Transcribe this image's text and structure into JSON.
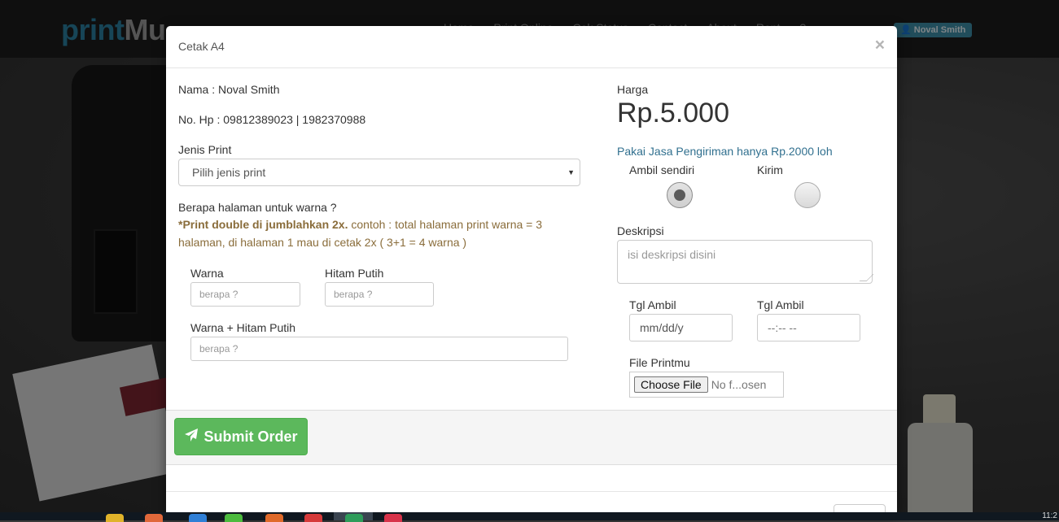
{
  "site": {
    "brand_part1": "print",
    "brand_part2": "Mu",
    "nav": [
      "Home",
      "Print Online",
      "Cek Status",
      "Contact",
      "About",
      "Rent",
      "?"
    ],
    "user_badge": "Noval Smith"
  },
  "modal": {
    "title": "Cetak A4",
    "close": "×",
    "left": {
      "nama": "Nama : Noval Smith",
      "hp": "No. Hp : 09812389023 | 1982370988",
      "jenis_label": "Jenis Print",
      "jenis_selected": "Pilih jenis print",
      "halaman_question": "Berapa halaman untuk warna ?",
      "note_bold": "*Print double di jumblahkan 2x.",
      "note_text": " contoh : total halaman print warna = 3 halaman, di halaman 1 mau di cetak 2x ( 3+1 = 4 warna )",
      "warna_label": "Warna",
      "warna_placeholder": "berapa ?",
      "hitam_label": "Hitam Putih",
      "hitam_placeholder": "berapa ?",
      "combo_label": "Warna + Hitam Putih",
      "combo_placeholder": "berapa ?"
    },
    "right": {
      "harga_label": "Harga",
      "harga_value": "Rp.5.000",
      "shipping_text": "Pakai Jasa Pengiriman hanya Rp.2000 loh",
      "option_pickup": "Ambil sendiri",
      "option_send": "Kirim",
      "selected_option": "Ambil sendiri",
      "deskripsi_label": "Deskripsi",
      "deskripsi_placeholder": "isi deskripsi disini",
      "tgl_label_1": "Tgl Ambil",
      "tgl_value_1": "mm/dd/y",
      "tgl_label_2": "Tgl Ambil",
      "tgl_value_2": "--:-- --",
      "file_label": "File Printmu",
      "file_button": "Choose File",
      "file_status": "No f...osen"
    },
    "submit_label": "Submit Order"
  },
  "taskbar": {
    "clock": "11:2"
  },
  "colors": {
    "submit_green": "#5cb85c",
    "note_brown": "#8a6d3b",
    "link_blue": "#31708f",
    "brand_blue": "#2a7f9e"
  }
}
